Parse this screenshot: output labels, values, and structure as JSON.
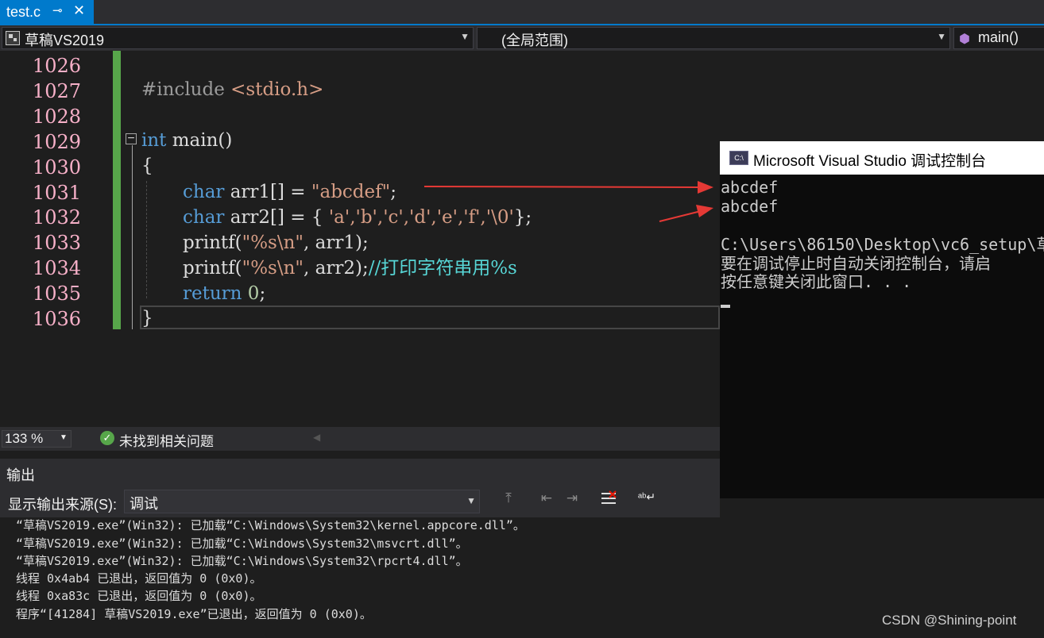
{
  "tab": {
    "title": "test.c",
    "pin_glyph": "⊸",
    "close_glyph": "✕"
  },
  "navbar": {
    "project": "草稿VS2019",
    "scope": "(全局范围)",
    "member": "main()"
  },
  "editor": {
    "line_numbers": [
      "1026",
      "1027",
      "1028",
      "1029",
      "1030",
      "1031",
      "1032",
      "1033",
      "1034",
      "1035",
      "1036"
    ],
    "lines": {
      "l1027_pre": "#include ",
      "l1027_hdr": "<stdio.h>",
      "l1029_kw": "int",
      "l1029_rest": " main()",
      "l1030": "{",
      "l1031_kw": "char",
      "l1031_mid": " arr1[] = ",
      "l1031_str": "\"abcdef\"",
      "l1031_end": ";",
      "l1032_kw": "char",
      "l1032_mid": " arr2[] = { ",
      "l1032_str": "'a','b','c','d','e','f','\\0'",
      "l1032_end": "};",
      "l1033_pre": "printf(",
      "l1033_str": "\"%s\\n\"",
      "l1033_end": ", arr1);",
      "l1034_pre": "printf(",
      "l1034_str": "\"%s\\n\"",
      "l1034_mid": ", arr2);",
      "l1034_cm": "//打印字符串用%s",
      "l1035_kw": "return",
      "l1035_num": " 0",
      "l1035_end": ";",
      "l1036": "}"
    },
    "fold_glyph": "−"
  },
  "status": {
    "zoom": "133 %",
    "issues": "未找到相关问题"
  },
  "output": {
    "header": "输出",
    "source_label": "显示输出来源(S):",
    "source_value": "调试",
    "lines": [
      "“草稿VS2019.exe”(Win32): 已加载“C:\\Windows\\System32\\kernel.appcore.dll”。",
      "“草稿VS2019.exe”(Win32): 已加载“C:\\Windows\\System32\\msvcrt.dll”。",
      "“草稿VS2019.exe”(Win32): 已加载“C:\\Windows\\System32\\rpcrt4.dll”。",
      "线程 0x4ab4 已退出，返回值为 0 (0x0)。",
      "线程 0xa83c 已退出，返回值为 0 (0x0)。",
      "程序“[41284] 草稿VS2019.exe”已退出，返回值为 0 (0x0)。"
    ]
  },
  "console": {
    "title": "Microsoft Visual Studio 调试控制台",
    "icon_text": "C:\\",
    "lines": [
      "abcdef",
      "abcdef",
      "",
      "C:\\Users\\86150\\Desktop\\vc6_setup\\草",
      "要在调试停止时自动关闭控制台，请启",
      "按任意键关闭此窗口. . ."
    ]
  },
  "watermark": "CSDN @Shining-point",
  "colors": {
    "accent": "#007acc",
    "line_numbers": "#f7b0c8",
    "change_bar": "#57a64a",
    "annotation_arrow": "#e53935"
  }
}
